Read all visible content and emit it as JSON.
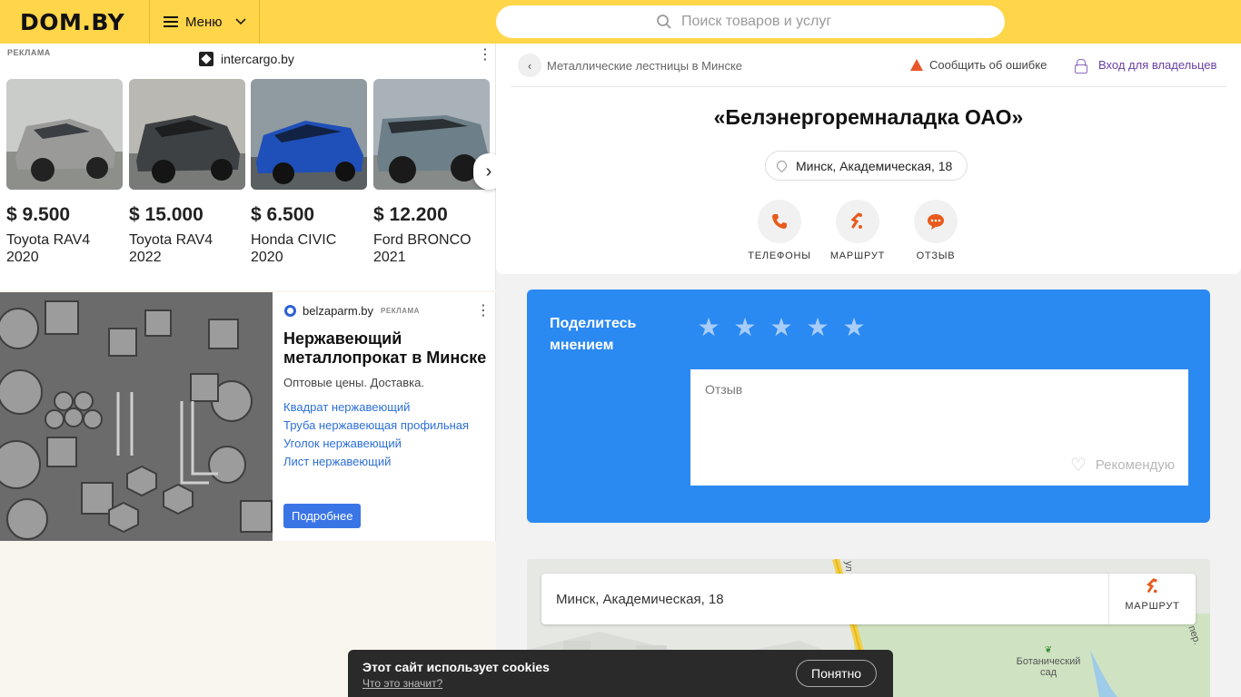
{
  "header": {
    "logo": "DOM.BY",
    "menu_label": "Меню",
    "search_placeholder": "Поиск товаров и услуг"
  },
  "ad1": {
    "tag": "РЕКЛАМА",
    "domain": "intercargo.by",
    "cars": [
      {
        "price": "$ 9.500",
        "name": "Toyota RAV4 2020",
        "color": "#9a9a98"
      },
      {
        "price": "$ 15.000",
        "name": "Toyota RAV4 2022",
        "color": "#3d4144"
      },
      {
        "price": "$ 6.500",
        "name": "Honda CIVIC 2020",
        "color": "#1f4fb8"
      },
      {
        "price": "$ 12.200",
        "name": "Ford BRONCO 2021",
        "color": "#6d7f88"
      }
    ]
  },
  "ad2": {
    "domain": "belzaparm.by",
    "tag": "РЕКЛАМА",
    "title": "Нержавеющий металлопрокат в Минске",
    "subtitle": "Оптовые цены. Доставка.",
    "links": [
      "Квадрат нержавеющий",
      "Труба нержавеющая профильная",
      "Уголок нержавеющий",
      "Лист нержавеющий"
    ],
    "button": "Подробнее"
  },
  "company": {
    "breadcrumb": "Металлические лестницы в Минске",
    "report": "Сообщить об ошибке",
    "owners": "Вход для владельцев",
    "name": "«Белэнергоремналадка ОАО»",
    "address": "Минск, Академическая, 18",
    "actions": {
      "phones": "ТЕЛЕФОНЫ",
      "route": "МАРШРУТ",
      "review": "ОТЗЫВ"
    }
  },
  "review": {
    "title": "Поделитесь мнением",
    "placeholder": "Отзыв",
    "recommend": "Рекомендую",
    "stars": 5
  },
  "map": {
    "address": "Минск, Академическая, 18",
    "route": "МАРШРУТ",
    "garden_label": "Ботанический сад",
    "street_label": "пер."
  },
  "cookie": {
    "title": "Этот сайт использует cookies",
    "link": "Что это значит?",
    "button": "Понятно"
  },
  "colors": {
    "header": "#ffd54a",
    "accent_blue": "#2b89f2",
    "action_orange": "#e85a1c"
  }
}
